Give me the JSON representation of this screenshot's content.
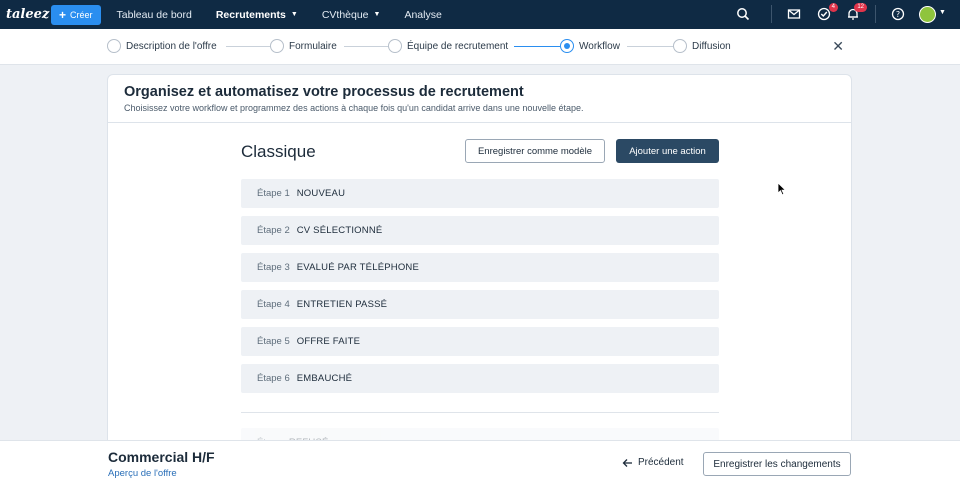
{
  "nav": {
    "logo": "taleez",
    "create_label": "Créer",
    "items": [
      {
        "label": "Tableau de bord"
      },
      {
        "label": "Recrutements"
      },
      {
        "label": "CVthèque"
      },
      {
        "label": "Analyse"
      }
    ],
    "tasks_badge": "4",
    "notifications_badge": "12"
  },
  "stepper": {
    "steps": [
      {
        "label": "Description de l'offre"
      },
      {
        "label": "Formulaire"
      },
      {
        "label": "Équipe de recrutement"
      },
      {
        "label": "Workflow"
      },
      {
        "label": "Diffusion"
      }
    ]
  },
  "card": {
    "title": "Organisez et automatisez votre processus de recrutement",
    "subtitle": "Choisissez votre workflow et programmez des actions à chaque fois qu'un candidat arrive dans une nouvelle étape.",
    "workflow_name": "Classique",
    "save_template_label": "Enregistrer comme modèle",
    "add_action_label": "Ajouter une action",
    "stages": [
      {
        "label": "Étape 1",
        "name": "NOUVEAU"
      },
      {
        "label": "Étape 2",
        "name": "CV SÉLECTIONNÉ"
      },
      {
        "label": "Étape 3",
        "name": "EVALUÉ PAR TÉLÉPHONE"
      },
      {
        "label": "Étape 4",
        "name": "ENTRETIEN PASSÉ"
      },
      {
        "label": "Étape 5",
        "name": "OFFRE FAITE"
      },
      {
        "label": "Étape 6",
        "name": "EMBAUCHÉ"
      }
    ],
    "extra_stage": {
      "label": "Étape",
      "name": "REFUSÉ"
    }
  },
  "bottom": {
    "job_title": "Commercial H/F",
    "preview_link": "Aperçu de l'offre",
    "previous_label": "Précédent",
    "save_changes_label": "Enregistrer les changements"
  }
}
